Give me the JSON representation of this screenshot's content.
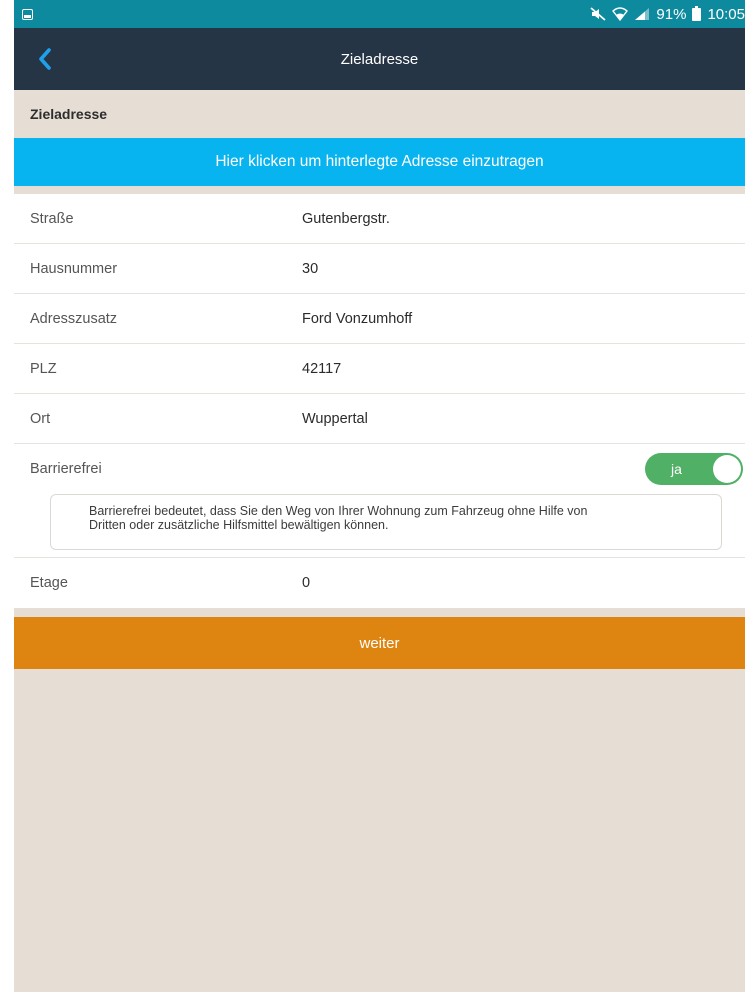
{
  "status_bar": {
    "battery_percent": "91%",
    "time": "10:05"
  },
  "nav": {
    "title": "Zieladresse"
  },
  "section": {
    "title": "Zieladresse"
  },
  "banner": {
    "label": "Hier klicken um hinterlegte Adresse einzutragen"
  },
  "form": {
    "rows": [
      {
        "label": "Straße",
        "value": "Gutenbergstr."
      },
      {
        "label": "Hausnummer",
        "value": "30"
      },
      {
        "label": "Adresszusatz",
        "value": "Ford Vonzumhoff"
      },
      {
        "label": "PLZ",
        "value": "42117"
      },
      {
        "label": "Ort",
        "value": "Wuppertal"
      }
    ],
    "barrierefrei": {
      "label": "Barrierefrei",
      "toggle_label": "ja",
      "on": true,
      "info_line1": "Barrierefrei bedeutet, dass Sie den Weg von Ihrer Wohnung zum Fahrzeug ohne Hilfe von",
      "info_line2": "Dritten oder zusätzliche Hilfsmittel bewältigen können."
    },
    "etage": {
      "label": "Etage",
      "value": "0"
    }
  },
  "actions": {
    "weiter_label": "weiter"
  },
  "colors": {
    "status_bar": "#0e8a9e",
    "nav_bar": "#263546",
    "banner": "#08b4f0",
    "toggle_on": "#50b066",
    "weiter": "#de8410",
    "background": "#e6ddd4"
  }
}
